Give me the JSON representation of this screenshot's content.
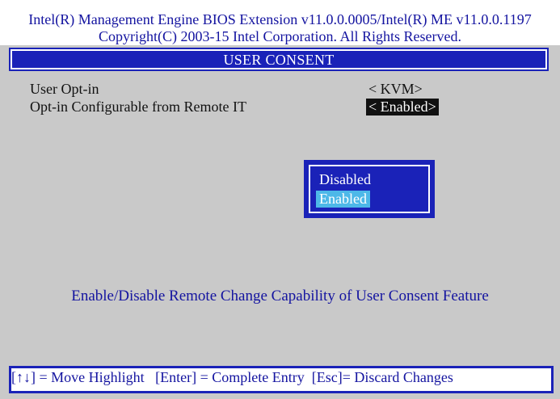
{
  "header": {
    "line1": "Intel(R) Management Engine BIOS Extension v11.0.0.0005/Intel(R) ME v11.0.0.1197",
    "line2": "Copyright(C) 2003-15 Intel Corporation. All Rights Reserved."
  },
  "title": "USER CONSENT",
  "settings": [
    {
      "label": "User Opt-in",
      "value": "< KVM>"
    },
    {
      "label": "Opt-in Configurable from Remote IT",
      "value": "< Enabled>",
      "selected": true
    }
  ],
  "popup": {
    "options": [
      "Disabled",
      "Enabled"
    ],
    "highlighted": "Enabled"
  },
  "help_text": "Enable/Disable Remote Change Capability of User Consent Feature",
  "footer": "[↑↓] = Move Highlight   [Enter] = Complete Entry  [Esc]= Discard Changes",
  "colors": {
    "background": "#c9c9c9",
    "accent_blue": "#1a22b8",
    "text_blue": "#1414a0",
    "highlight": "#4db8e8"
  }
}
